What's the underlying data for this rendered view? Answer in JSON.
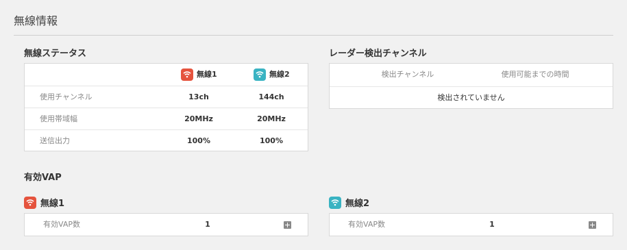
{
  "page": {
    "title": "無線情報"
  },
  "status": {
    "heading": "無線ステータス",
    "columns": [
      {
        "label": "無線1",
        "icon": "wifi-icon",
        "color": "#e5533d"
      },
      {
        "label": "無線2",
        "icon": "wifi-icon",
        "color": "#39b3c2"
      }
    ],
    "rows": [
      {
        "label": "使用チャンネル",
        "values": [
          "13ch",
          "144ch"
        ]
      },
      {
        "label": "使用帯域幅",
        "values": [
          "20MHz",
          "20MHz"
        ]
      },
      {
        "label": "送信出力",
        "values": [
          "100%",
          "100%"
        ]
      }
    ]
  },
  "radar": {
    "heading": "レーダー検出チャンネル",
    "columns": [
      "検出チャンネル",
      "使用可能までの時間"
    ],
    "empty_message": "検出されていません"
  },
  "vap": {
    "heading": "有効VAP",
    "bands": [
      {
        "title": "無線1",
        "icon": "wifi-icon",
        "color": "#e5533d",
        "label": "有効VAP数",
        "count": "1"
      },
      {
        "title": "無線2",
        "icon": "wifi-icon",
        "color": "#39b3c2",
        "label": "有効VAP数",
        "count": "1"
      }
    ]
  }
}
